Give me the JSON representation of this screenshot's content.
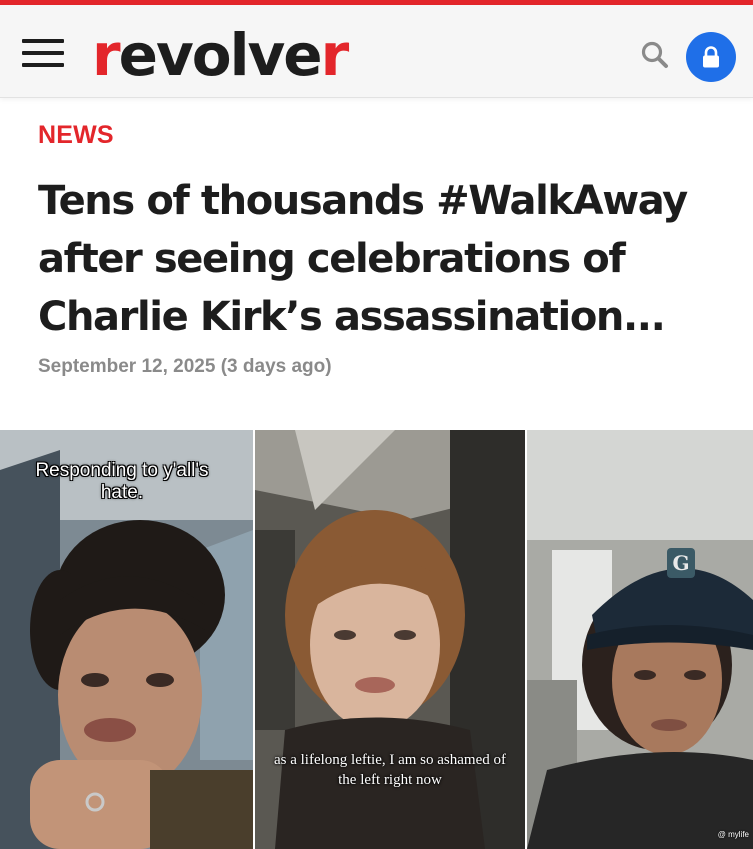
{
  "header": {
    "logo": {
      "first": "r",
      "middle": "evolve",
      "last": "r"
    },
    "menu_icon": "hamburger-menu-icon",
    "search_icon": "search-icon",
    "lock_icon": "lock-icon",
    "accent_color": "#e3262b",
    "lock_color": "#1f6fe8"
  },
  "article": {
    "category": "NEWS",
    "headline": "Tens of thousands #WalkAway after seeing celebrations of Charlie Kirk’s assassination...",
    "date": "September 12, 2025 (3 days ago)"
  },
  "media": {
    "panel1_overlay": "Responding to y'all's hate.",
    "panel2_caption": "as a lifelong leftie, I am so ashamed of the left right now",
    "panel3_watermark": "@ mylife"
  }
}
